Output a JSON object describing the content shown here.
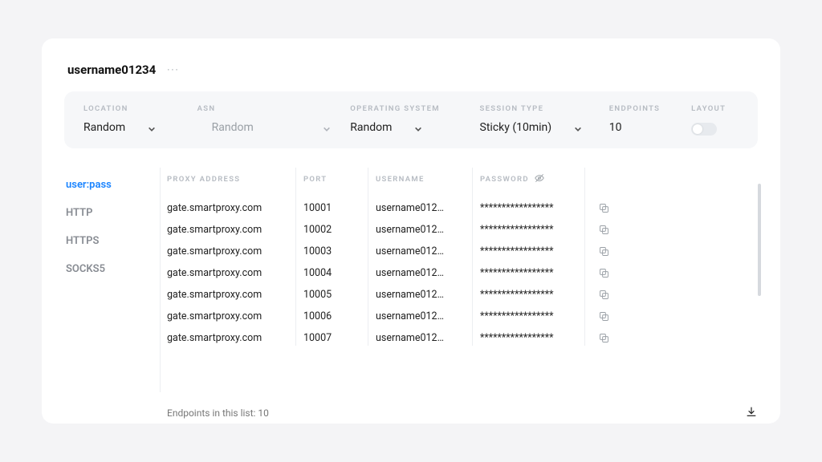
{
  "header": {
    "username": "username01234"
  },
  "filters": {
    "location": {
      "label": "LOCATION",
      "value": "Random"
    },
    "asn": {
      "label": "ASN",
      "value": "Random"
    },
    "os": {
      "label": "OPERATING SYSTEM",
      "value": "Random"
    },
    "session": {
      "label": "SESSION TYPE",
      "value": "Sticky (10min)"
    },
    "endpoints": {
      "label": "ENDPOINTS",
      "value": "10"
    },
    "layout": {
      "label": "LAYOUT"
    }
  },
  "tabs": [
    {
      "id": "userpass",
      "label": "user:pass",
      "active": true
    },
    {
      "id": "http",
      "label": "HTTP"
    },
    {
      "id": "https",
      "label": "HTTPS"
    },
    {
      "id": "socks5",
      "label": "SOCKS5"
    }
  ],
  "columns": {
    "addr": "PROXY ADDRESS",
    "port": "PORT",
    "user": "USERNAME",
    "pwd": "PASSWORD"
  },
  "rows": [
    {
      "addr": "gate.smartproxy.com",
      "port": "10001",
      "user": "username012…",
      "pwd": "*****************"
    },
    {
      "addr": "gate.smartproxy.com",
      "port": "10002",
      "user": "username012…",
      "pwd": "*****************"
    },
    {
      "addr": "gate.smartproxy.com",
      "port": "10003",
      "user": "username012…",
      "pwd": "*****************"
    },
    {
      "addr": "gate.smartproxy.com",
      "port": "10004",
      "user": "username012…",
      "pwd": "*****************"
    },
    {
      "addr": "gate.smartproxy.com",
      "port": "10005",
      "user": "username012…",
      "pwd": "*****************"
    },
    {
      "addr": "gate.smartproxy.com",
      "port": "10006",
      "user": "username012…",
      "pwd": "*****************"
    },
    {
      "addr": "gate.smartproxy.com",
      "port": "10007",
      "user": "username012…",
      "pwd": "*****************"
    }
  ],
  "footer": {
    "count_prefix": "Endpoints in this list: ",
    "count": "10"
  }
}
